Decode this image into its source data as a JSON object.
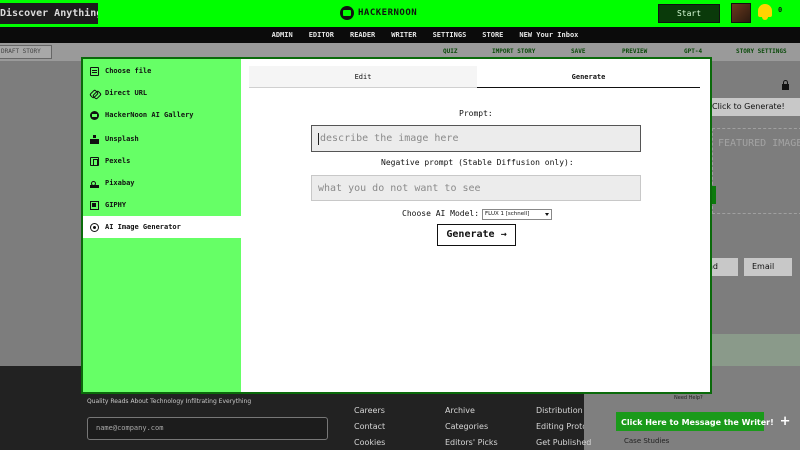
{
  "header": {
    "search_text": "Discover Anything",
    "logo_text": "HACKERNOON",
    "start_writing": "Start Writing",
    "coin_text": "0"
  },
  "nav": {
    "items": [
      "ADMIN",
      "EDITOR",
      "READER",
      "WRITER",
      "SETTINGS",
      "STORE",
      "NEW Your Inbox"
    ]
  },
  "toolbar": {
    "draft_story": "DRAFT STORY",
    "quiz": "QUIZ",
    "import_story": "IMPORT STORY",
    "save": "SAVE",
    "preview": "PREVIEW",
    "gpt": "GPT-4",
    "story_settings": "STORY SETTINGS"
  },
  "background_page": {
    "click_to_generate": "Click to Generate!",
    "featured_image": "FEATURED IMAGE",
    "share_label": "ad",
    "email_label": "Email"
  },
  "modal": {
    "sidebar": {
      "items": [
        {
          "label": "Choose file",
          "icon": "file-icon"
        },
        {
          "label": "Direct URL",
          "icon": "link-icon"
        },
        {
          "label": "HackerNoon AI Gallery",
          "icon": "hackernoon-icon"
        },
        {
          "label": "Unsplash",
          "icon": "unsplash-icon"
        },
        {
          "label": "Pexels",
          "icon": "pexels-icon"
        },
        {
          "label": "Pixabay",
          "icon": "pixabay-icon"
        },
        {
          "label": "GIPHY",
          "icon": "giphy-icon"
        },
        {
          "label": "AI Image Generator",
          "icon": "ai-generator-icon",
          "active": true
        }
      ]
    },
    "tabs": {
      "edit": "Edit",
      "generate": "Generate"
    },
    "prompt_label": "Prompt:",
    "prompt_placeholder": "describe the image here",
    "negative_label": "Negative prompt (Stable Diffusion only):",
    "negative_placeholder": "what you do not want to see",
    "model_label": "Choose AI Model:",
    "model_selected": "FLUX 1 [schnell]",
    "generate_button": "Generate →"
  },
  "footer": {
    "tagline": "Quality Reads About Technology Infiltrating Everything",
    "newsletter_placeholder": "name@company.com",
    "col1": [
      "Careers",
      "Contact",
      "Cookies"
    ],
    "col2": [
      "Archive",
      "Categories",
      "Editors' Picks"
    ],
    "col3": [
      "Distribution",
      "Editing Protocol",
      "Get Published"
    ],
    "need_help": "Need Help?",
    "message_writer": "Click Here to Message the Writer!",
    "case_studies": "Case Studies"
  },
  "colors": {
    "brand_green": "#00ff00",
    "sidebar_green": "#66ff66",
    "dark": "#0b0b0b"
  }
}
